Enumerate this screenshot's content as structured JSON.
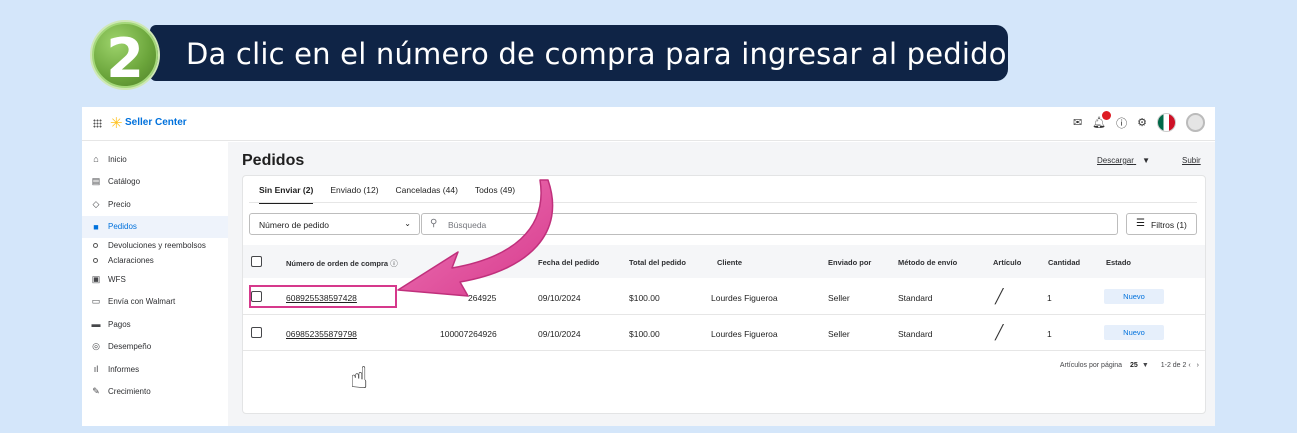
{
  "banner": {
    "step_number": "2",
    "title": "Da clic en el número de compra para ingresar al pedido"
  },
  "topbar": {
    "brand": "Seller Center",
    "icons": [
      "apps-grid-icon",
      "walmart-spark-icon",
      "mail-icon",
      "bell-icon",
      "help-icon",
      "gear-icon",
      "mexico-flag-icon",
      "avatar-icon"
    ]
  },
  "sidebar": {
    "items": [
      {
        "label": "Inicio",
        "icon": "home-icon"
      },
      {
        "label": "Catálogo",
        "icon": "catalog-icon"
      },
      {
        "label": "Precio",
        "icon": "tag-icon"
      },
      {
        "label": "Pedidos",
        "icon": "truck-icon",
        "active": true
      },
      {
        "label": "Devoluciones y reembolsos",
        "sub": true
      },
      {
        "label": "Aclaraciones",
        "sub": true
      },
      {
        "label": "WFS",
        "icon": "warehouse-icon"
      },
      {
        "label": "Envía con Walmart",
        "icon": "shipping-icon"
      },
      {
        "label": "Pagos",
        "icon": "payments-icon"
      },
      {
        "label": "Desempeño",
        "icon": "performance-icon"
      },
      {
        "label": "Informes",
        "icon": "reports-icon"
      },
      {
        "label": "Crecimiento",
        "icon": "growth-icon"
      }
    ]
  },
  "main": {
    "title": "Pedidos",
    "download_label": "Descargar",
    "upload_label": "Subir",
    "tabs": [
      "Sin Enviar (2)",
      "Enviado (12)",
      "Canceladas (44)",
      "Todos (49)"
    ],
    "filter_select": "Número de pedido",
    "search_placeholder": "Búsqueda",
    "filters_label": "Filtros (1)",
    "columns": [
      "Número de orden de compra",
      "Fecha del pedido",
      "Total del pedido",
      "Cliente",
      "Enviado por",
      "Método de envío",
      "Artículo",
      "Cantidad",
      "Estado"
    ],
    "rows": [
      {
        "order": "608925538597428",
        "ref": "264925",
        "date": "09/10/2024",
        "total": "$100.00",
        "client": "Lourdes Figueroa",
        "sent_by": "Seller",
        "method": "Standard",
        "qty": "1",
        "status": "Nuevo"
      },
      {
        "order": "069852355879798",
        "ref": "100007264926",
        "date": "09/10/2024",
        "total": "$100.00",
        "client": "Lourdes Figueroa",
        "sent_by": "Seller",
        "method": "Standard",
        "qty": "1",
        "status": "Nuevo"
      }
    ],
    "pager": {
      "label": "Artículos por página",
      "per_page": "25",
      "range": "1-2 de 2"
    }
  },
  "colors": {
    "banner_bg": "#0f2446",
    "step_green": "#6aa43a",
    "arrow_pink": "#d6398c",
    "brand_blue": "#0071dc"
  }
}
